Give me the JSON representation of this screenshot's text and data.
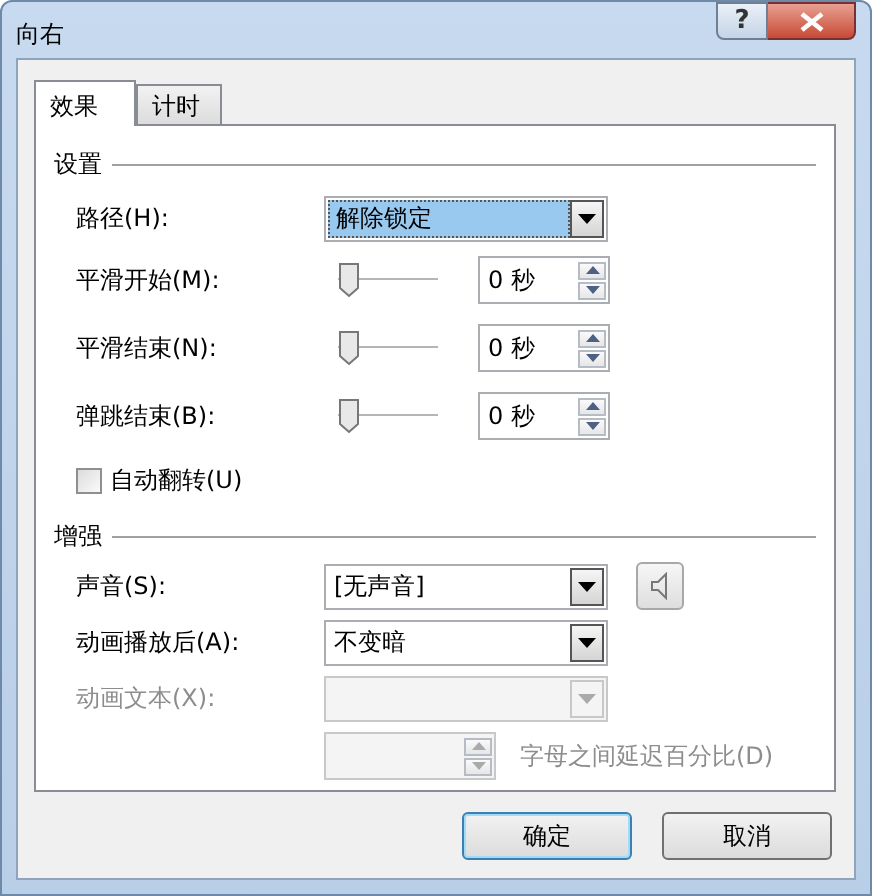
{
  "window": {
    "title": "向右",
    "help": "?"
  },
  "tabs": [
    {
      "label": "效果",
      "selected": true
    },
    {
      "label": "计时",
      "selected": false
    }
  ],
  "sections": [
    {
      "title": "设置",
      "rows": [
        {
          "kind": "dropdown",
          "label": "路径(H):",
          "value": "解除锁定",
          "focused": true,
          "disabled": false
        },
        {
          "kind": "slider",
          "label": "平滑开始(M):",
          "level": 0,
          "value": "0 秒",
          "disabled": false
        },
        {
          "kind": "slider",
          "label": "平滑结束(N):",
          "level": 0,
          "value": "0 秒",
          "disabled": false
        },
        {
          "kind": "slider",
          "label": "弹跳结束(B):",
          "level": 0,
          "value": "0 秒",
          "disabled": false
        },
        {
          "kind": "checkbox",
          "label": "自动翻转(U)",
          "checked": false,
          "disabled": false
        }
      ]
    },
    {
      "title": "增强",
      "rows": [
        {
          "kind": "sound",
          "label": "声音(S):",
          "value": "[无声音]",
          "focused": false,
          "disabled": false
        },
        {
          "kind": "dropdown",
          "label": "动画播放后(A):",
          "value": "不变暗",
          "focused": false,
          "disabled": false
        },
        {
          "kind": "dropdown",
          "label": "动画文本(X):",
          "focused": false,
          "disabled": true
        },
        {
          "kind": "spin",
          "label": "字母之间延迟百分比(D)",
          "disabled": true
        }
      ]
    }
  ],
  "buttons": [
    {
      "label": "确定",
      "default": true
    },
    {
      "label": "取消",
      "default": false
    }
  ]
}
